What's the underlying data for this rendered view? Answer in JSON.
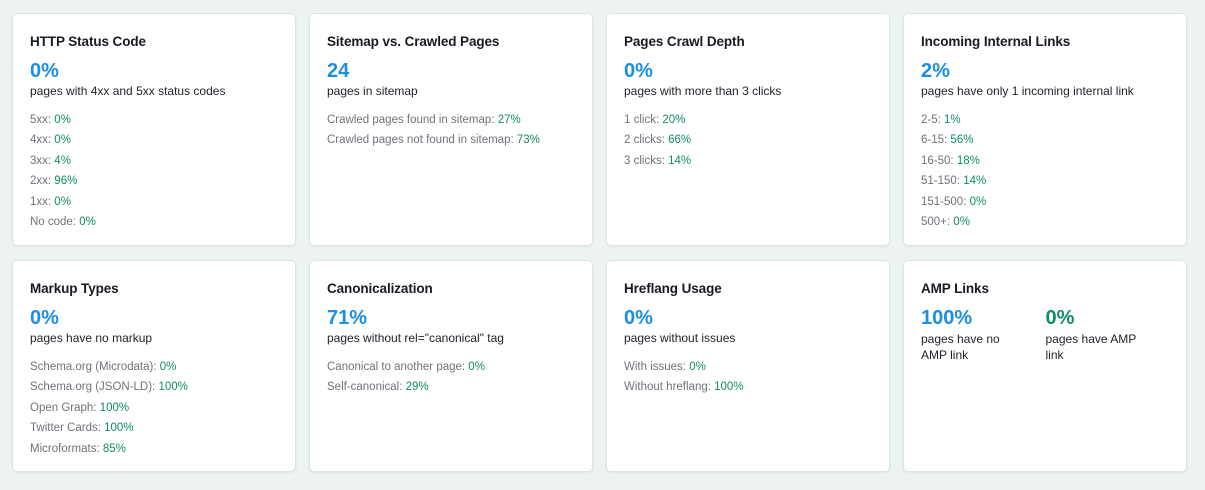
{
  "colors": {
    "background": "#edf3f3",
    "card": "#ffffff",
    "accent_blue": "#1a8fe3",
    "value_green": "#138a68",
    "muted_text": "#6f737a"
  },
  "cards": [
    {
      "title": "HTTP Status Code",
      "value": "0%",
      "subtitle": "pages with 4xx and 5xx status codes",
      "stats": [
        {
          "label": "5xx: ",
          "value": "0%"
        },
        {
          "label": "4xx: ",
          "value": "0%"
        },
        {
          "label": "3xx: ",
          "value": "4%"
        },
        {
          "label": "2xx: ",
          "value": "96%"
        },
        {
          "label": "1xx: ",
          "value": "0%"
        },
        {
          "label": "No code: ",
          "value": "0%"
        }
      ]
    },
    {
      "title": "Sitemap vs. Crawled Pages",
      "value": "24",
      "subtitle": "pages in sitemap",
      "stats": [
        {
          "label": "Crawled pages found in sitemap: ",
          "value": "27%"
        },
        {
          "label": "Crawled pages not found in sitemap: ",
          "value": "73%"
        }
      ]
    },
    {
      "title": "Pages Crawl Depth",
      "value": "0%",
      "subtitle": "pages with more than 3 clicks",
      "stats": [
        {
          "label": "1 click: ",
          "value": "20%"
        },
        {
          "label": "2 clicks: ",
          "value": "66%"
        },
        {
          "label": "3 clicks: ",
          "value": "14%"
        }
      ]
    },
    {
      "title": "Incoming Internal Links",
      "value": "2%",
      "subtitle": "pages have only 1 incoming internal link",
      "stats": [
        {
          "label": "2-5: ",
          "value": "1%"
        },
        {
          "label": "6-15: ",
          "value": "56%"
        },
        {
          "label": "16-50: ",
          "value": "18%"
        },
        {
          "label": "51-150: ",
          "value": "14%"
        },
        {
          "label": "151-500: ",
          "value": "0%"
        },
        {
          "label": "500+: ",
          "value": "0%"
        }
      ]
    },
    {
      "title": "Markup Types",
      "value": "0%",
      "subtitle": "pages have no markup",
      "stats": [
        {
          "label": "Schema.org (Microdata): ",
          "value": "0%"
        },
        {
          "label": "Schema.org (JSON-LD): ",
          "value": "100%"
        },
        {
          "label": "Open Graph: ",
          "value": "100%"
        },
        {
          "label": "Twitter Cards: ",
          "value": "100%"
        },
        {
          "label": "Microformats: ",
          "value": "85%"
        }
      ]
    },
    {
      "title": "Canonicalization",
      "value": "71%",
      "subtitle": "pages without rel=\"canonical\" tag",
      "stats": [
        {
          "label": "Canonical to another page: ",
          "value": "0%"
        },
        {
          "label": "Self-canonical: ",
          "value": "29%"
        }
      ]
    },
    {
      "title": "Hreflang Usage",
      "value": "0%",
      "subtitle": "pages without issues",
      "stats": [
        {
          "label": "With issues: ",
          "value": "0%"
        },
        {
          "label": "Without hreflang: ",
          "value": "100%"
        }
      ]
    },
    {
      "title": "AMP Links",
      "amp": [
        {
          "value": "100%",
          "subtitle": "pages have no AMP link"
        },
        {
          "value": "0%",
          "subtitle": "pages have AMP link"
        }
      ]
    }
  ]
}
